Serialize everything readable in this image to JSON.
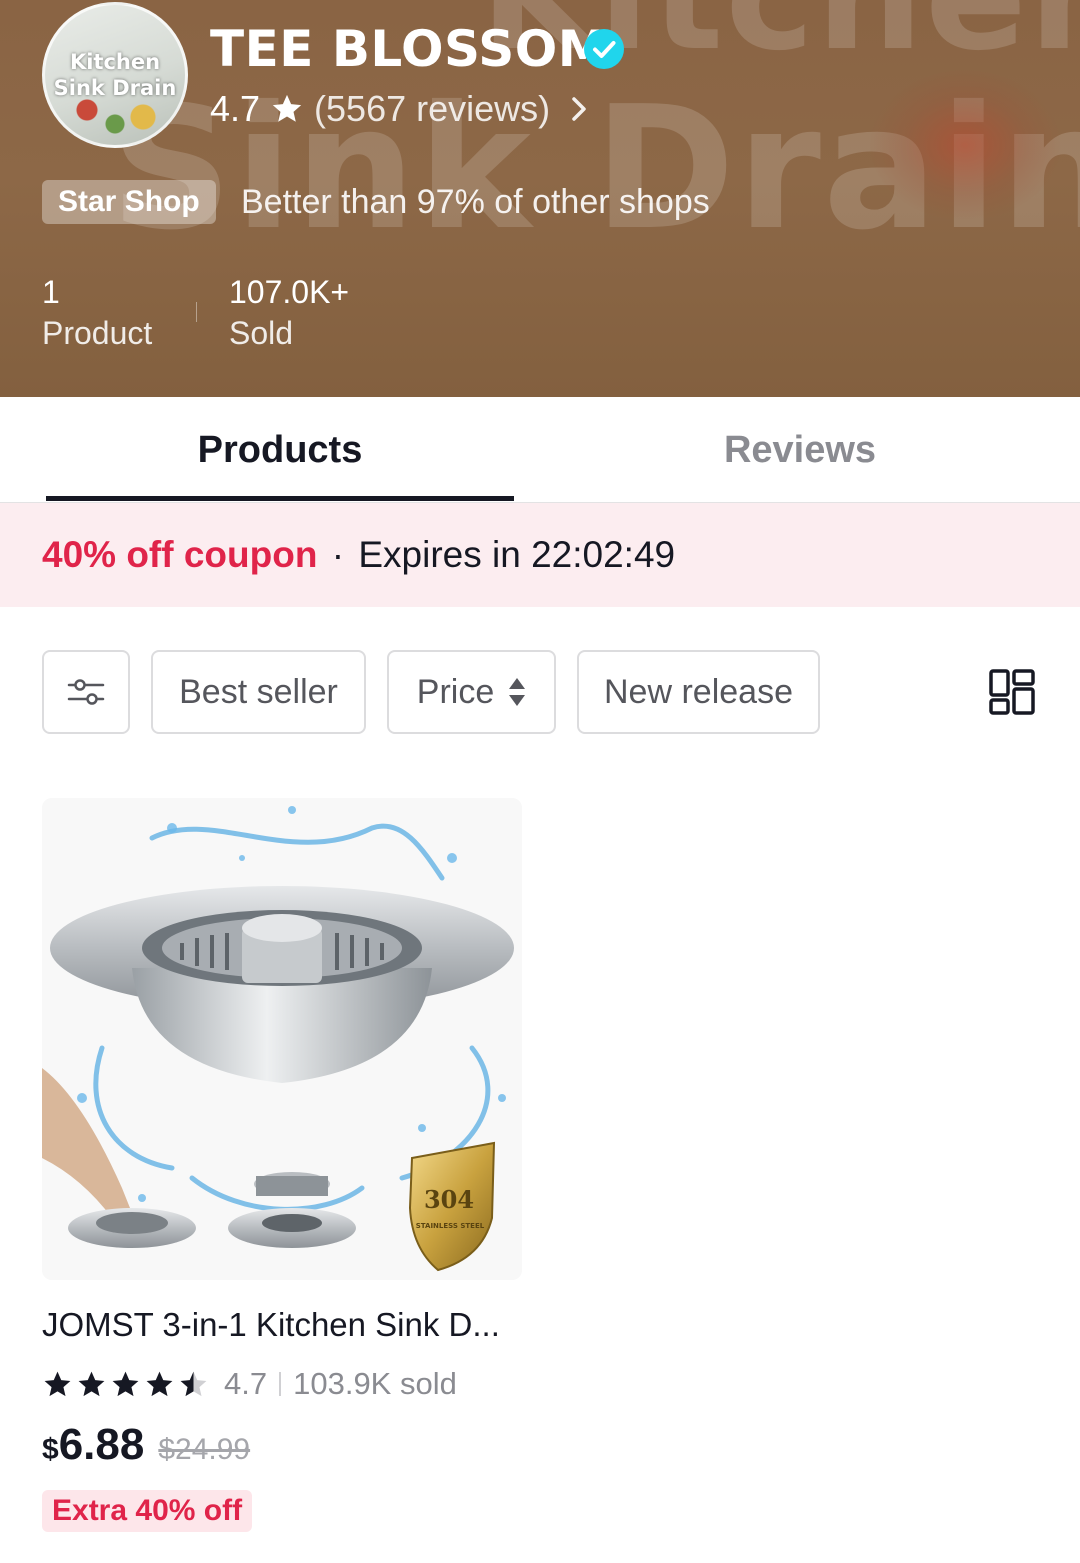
{
  "shop": {
    "avatar_text": "Kitchen Sink Drain",
    "background_text_top": "Kitchen",
    "background_text_main": "Sink Drain",
    "name": "TEE BLOSSOM",
    "rating": "4.7",
    "reviews": "(5567 reviews)",
    "badge": "Star Shop",
    "badge_description": "Better than 97% of other shops",
    "stats": [
      {
        "value": "1",
        "label": "Product"
      },
      {
        "value": "107.0K+",
        "label": "Sold"
      }
    ],
    "verified_color": "#20d5ec"
  },
  "tabs": [
    {
      "label": "Products",
      "active": true
    },
    {
      "label": "Reviews",
      "active": false
    }
  ],
  "coupon": {
    "offer": "40% off coupon",
    "separator": "·",
    "expires": "Expires in 22:02:49",
    "accent_color": "#e0244a"
  },
  "filters": {
    "filter_icon": "filter-sliders-icon",
    "options": [
      "Best seller",
      "Price",
      "New release"
    ],
    "layout_icon": "grid-layout-icon"
  },
  "products": [
    {
      "title": "JOMST 3-in-1 Kitchen Sink D...",
      "rating": "4.7",
      "sold": "103.9K sold",
      "currency": "$",
      "price": "6.88",
      "original_price": "$24.99",
      "promo": "Extra 40% off",
      "image_badge": {
        "number": "304",
        "text": "STAINLESS STEEL"
      }
    }
  ]
}
